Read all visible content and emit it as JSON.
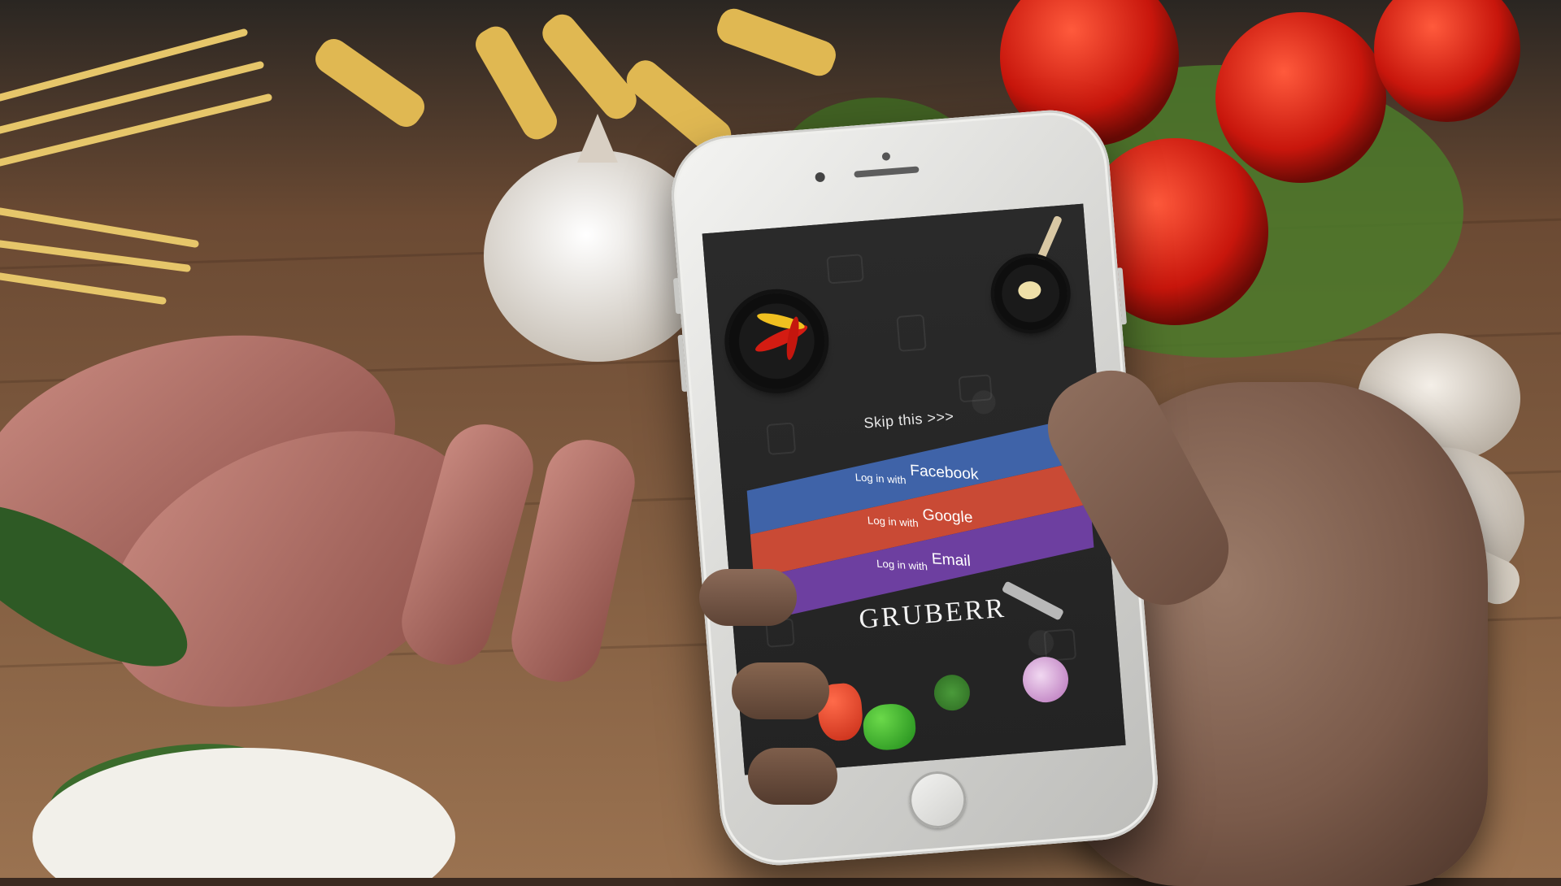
{
  "app": {
    "brand": "Gruberr",
    "skip_label": "Skip this >>>"
  },
  "login": {
    "facebook": {
      "prefix": "Log in with",
      "provider": "Facebook",
      "color": "#3f63a8"
    },
    "google": {
      "prefix": "Log in with",
      "provider": "Google",
      "color": "#c94a35"
    },
    "email": {
      "prefix": "Log in with",
      "provider": "Email",
      "color": "#6d3fa0"
    }
  },
  "icons": {
    "pan_left": "frying-pan-with-chili-icon",
    "pan_right": "frying-pan-with-garlic-icon",
    "spatula": "spatula-icon",
    "vegetables": [
      "red-bell-pepper-icon",
      "green-bell-pepper-icon",
      "parsley-icon",
      "garlic-icon"
    ]
  }
}
